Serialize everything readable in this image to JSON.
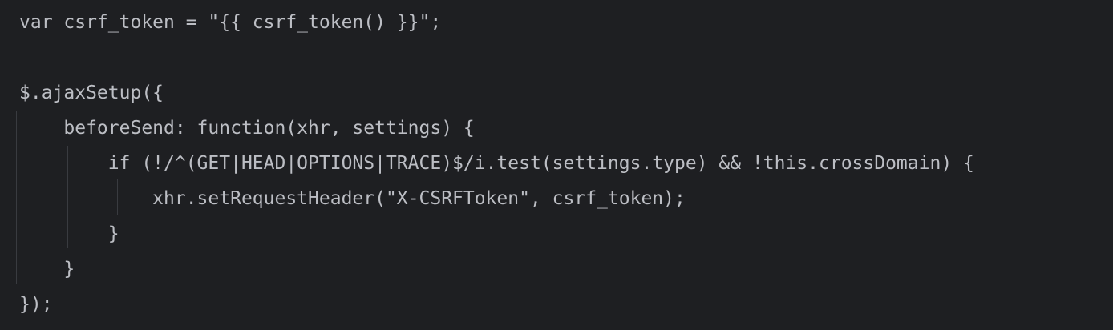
{
  "editor": {
    "background": "#1e1f22",
    "text_color": "#bcbec4",
    "indent_guide_color": "#393b40",
    "lines": [
      "var csrf_token = \"{{ csrf_token() }}\";",
      "",
      "$.ajaxSetup({",
      "    beforeSend: function(xhr, settings) {",
      "        if (!/^(GET|HEAD|OPTIONS|TRACE)$/i.test(settings.type) && !this.crossDomain) {",
      "            xhr.setRequestHeader(\"X-CSRFToken\", csrf_token);",
      "        }",
      "    }",
      "});"
    ]
  }
}
